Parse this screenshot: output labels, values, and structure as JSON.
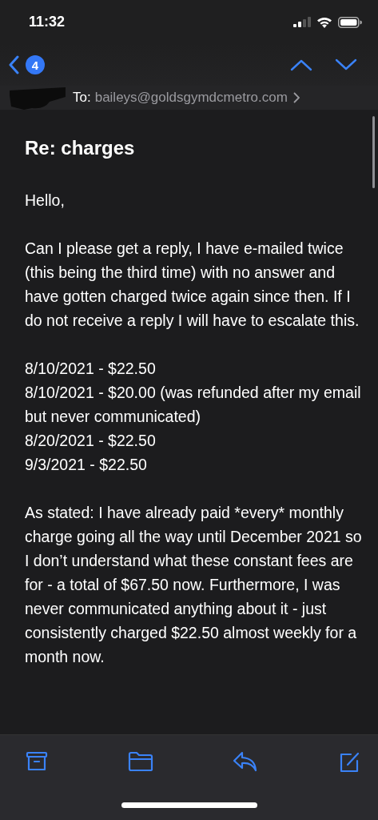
{
  "status_bar": {
    "time": "11:32"
  },
  "nav": {
    "unread_count": "4"
  },
  "header": {
    "to_label": "To:",
    "recipient": "baileys@goldsgymdcmetro.com"
  },
  "subject": "Re: charges",
  "body": [
    {
      "kind": "paragraph",
      "text": "Hello,"
    },
    {
      "kind": "paragraph",
      "text": "Can I please get a reply, I have e-mailed twice (this being the third time) with no answer and have gotten charged twice again since then. If I do not receive a reply I will have to escalate this."
    },
    {
      "kind": "lines",
      "lines": [
        "8/10/2021 - $22.50",
        "8/10/2021 - $20.00 (was refunded after my email but never communicated)",
        "8/20/2021 - $22.50",
        "9/3/2021 - $22.50"
      ]
    },
    {
      "kind": "paragraph",
      "text": "As stated: I have already paid *every* monthly charge going all the way until December 2021 so I don’t understand what these constant fees are for - a total of $67.50 now. Furthermore, I was never communicated anything about it - just consistently charged $22.50 almost weekly for a month now."
    }
  ]
}
